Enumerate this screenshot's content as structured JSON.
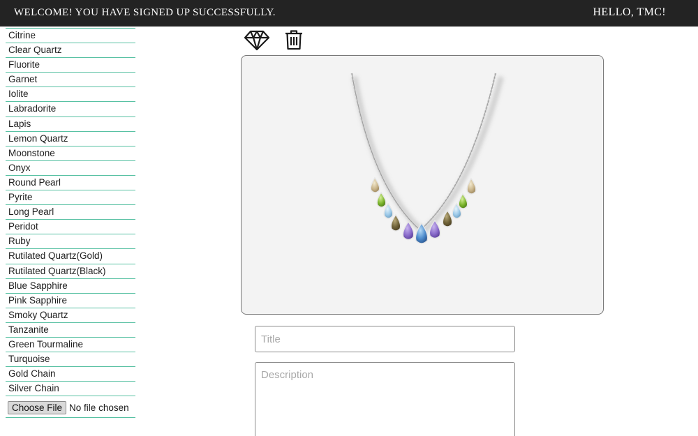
{
  "header": {
    "welcome": "WELCOME! YOU HAVE SIGNED UP SUCCESSFULLY.",
    "greeting": "HELLO, TMC!"
  },
  "sidebar": {
    "items": [
      {
        "label": "Citrine"
      },
      {
        "label": "Clear Quartz"
      },
      {
        "label": "Fluorite"
      },
      {
        "label": "Garnet"
      },
      {
        "label": "Iolite"
      },
      {
        "label": "Labradorite"
      },
      {
        "label": "Lapis"
      },
      {
        "label": "Lemon Quartz"
      },
      {
        "label": "Moonstone"
      },
      {
        "label": "Onyx"
      },
      {
        "label": "Round Pearl"
      },
      {
        "label": "Pyrite"
      },
      {
        "label": "Long Pearl"
      },
      {
        "label": "Peridot"
      },
      {
        "label": "Ruby"
      },
      {
        "label": "Rutilated Quartz(Gold)"
      },
      {
        "label": "Rutilated Quartz(Black)"
      },
      {
        "label": "Blue Sapphire"
      },
      {
        "label": "Pink Sapphire"
      },
      {
        "label": "Smoky Quartz"
      },
      {
        "label": "Tanzanite"
      },
      {
        "label": "Green Tourmaline"
      },
      {
        "label": "Turquoise"
      },
      {
        "label": "Gold Chain"
      },
      {
        "label": "Silver Chain"
      }
    ],
    "file_button": "Choose File",
    "file_status": "No file chosen"
  },
  "toolbar": {
    "icons": [
      "diamond-icon",
      "trash-icon"
    ]
  },
  "form": {
    "title_placeholder": "Title",
    "description_placeholder": "Description",
    "title_value": "",
    "description_value": ""
  },
  "colors": {
    "header_bg": "#232323",
    "divider": "#58c1a3",
    "canvas_bg": "#f3f3f3"
  }
}
